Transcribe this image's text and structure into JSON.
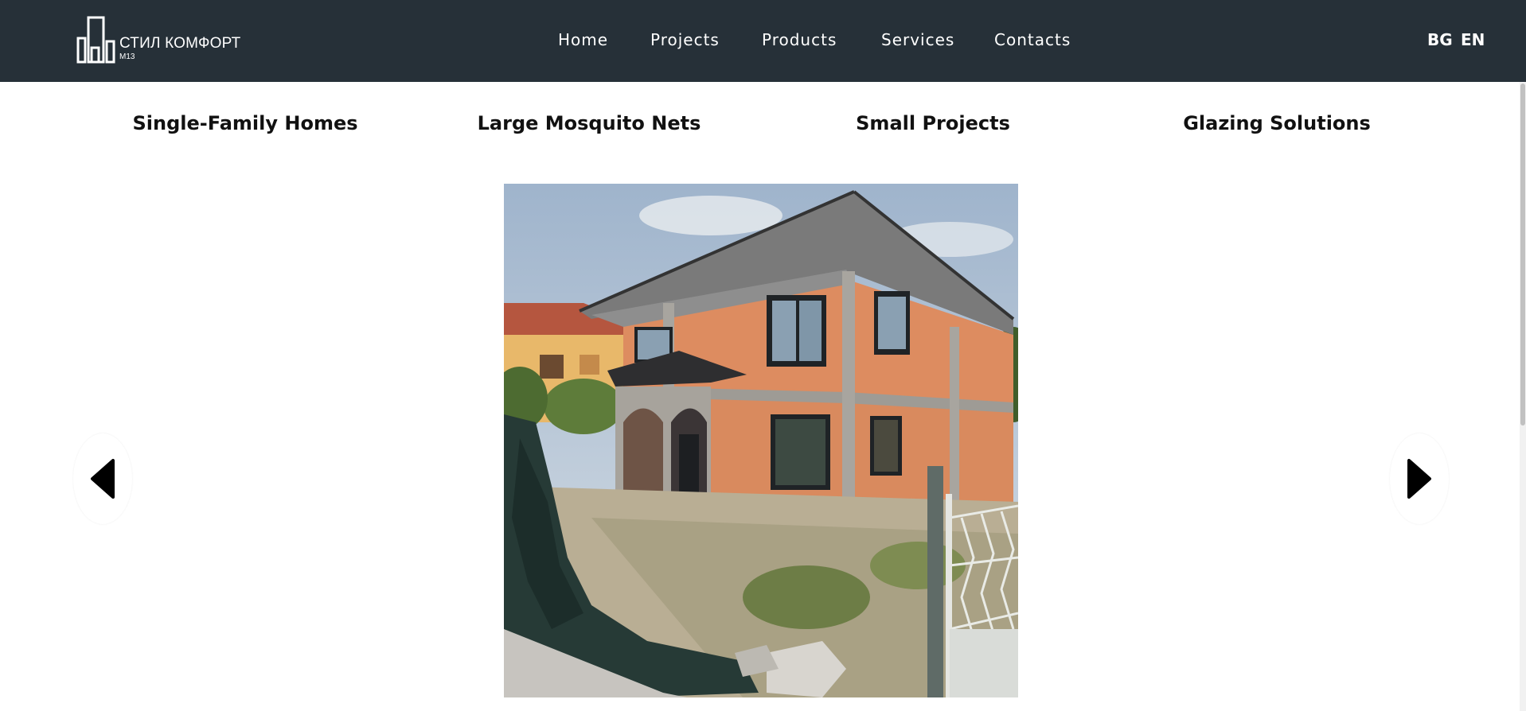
{
  "brand": {
    "name": "СТИЛ КОМФОРТ",
    "sub": "M13",
    "icon": "building-logo-icon"
  },
  "nav": {
    "items": [
      {
        "label": "Home"
      },
      {
        "label": "Projects"
      },
      {
        "label": "Products"
      },
      {
        "label": "Services"
      },
      {
        "label": "Contacts"
      }
    ],
    "lang_bg": "BG",
    "lang_en": "EN"
  },
  "categories": [
    {
      "label": "Single-Family Homes"
    },
    {
      "label": "Large Mosquito Nets"
    },
    {
      "label": "Small Projects"
    },
    {
      "label": "Glazing Solutions"
    }
  ],
  "slider": {
    "prev_icon": "triangle-left-icon",
    "next_icon": "triangle-right-icon",
    "image_subject": "house-under-construction-photo"
  },
  "colors": {
    "header_bg": "#263038",
    "text_light": "#ffffff",
    "text_dark": "#111111"
  }
}
